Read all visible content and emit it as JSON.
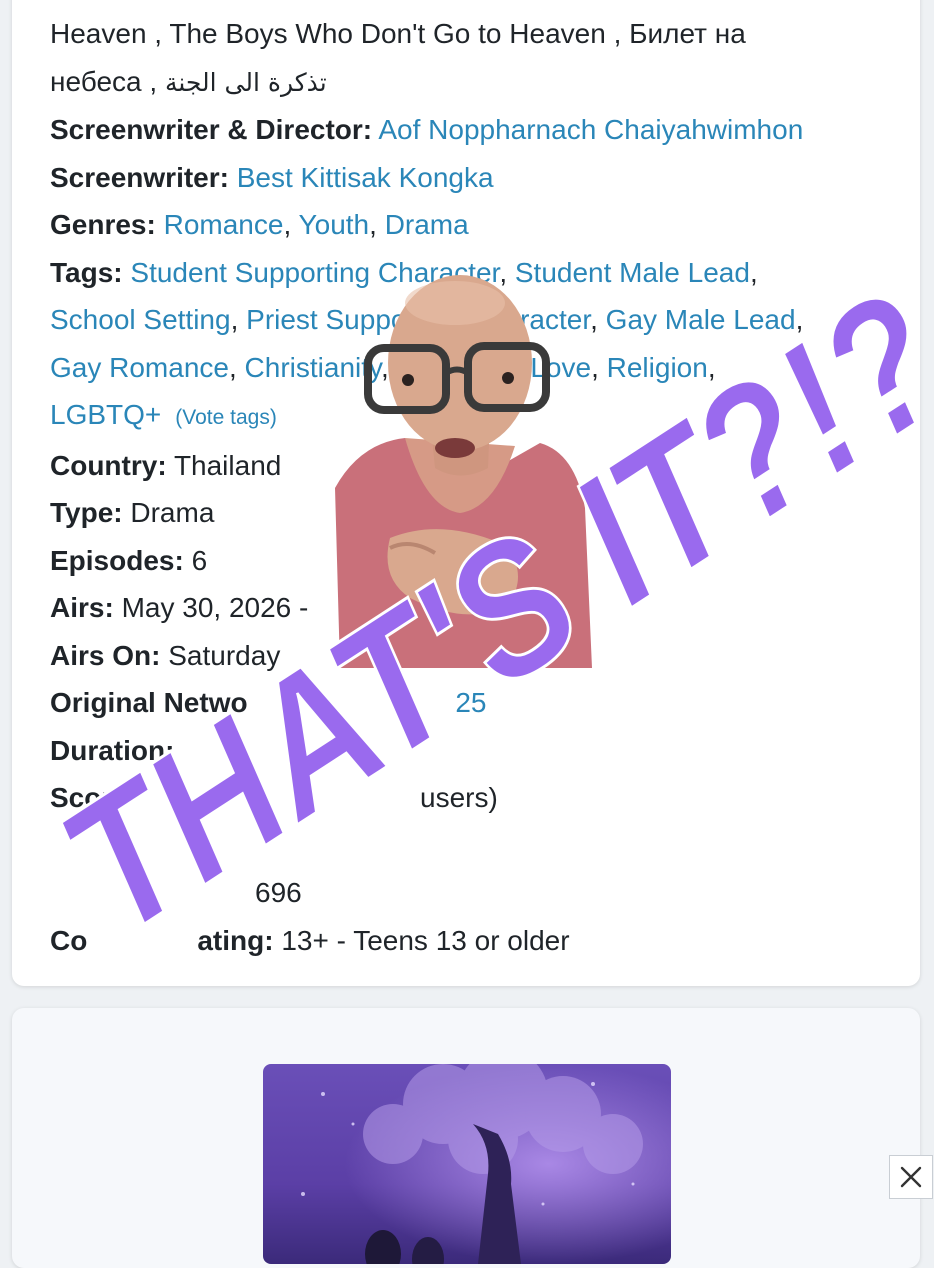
{
  "details": {
    "alt_titles_line1": "Heaven , The Boys Who Don't Go to Heaven , Билет на",
    "alt_titles_line2_ru": "небеса ,",
    "alt_titles_line2_ar": "تذكرة الى الجنة",
    "screenwriter_director": {
      "label": "Screenwriter & Director:",
      "value": "Aof Noppharnach Chaiyahwimhon"
    },
    "screenwriter": {
      "label": "Screenwriter:",
      "value": "Best Kittisak Kongka"
    },
    "genres": {
      "label": "Genres:",
      "items": [
        "Romance",
        "Youth",
        "Drama"
      ]
    },
    "tags": {
      "label": "Tags:",
      "line1": [
        "Student Supporting Character",
        "Student Male Lead"
      ],
      "line2": [
        "School Setting",
        "Priest Supporting Character",
        "Gay Male Lead"
      ],
      "line3": [
        "Gay Romance",
        "Christianity",
        "Forbidden Love",
        "Religion"
      ],
      "line4": "LGBTQ+",
      "vote": "(Vote tags)"
    },
    "country": {
      "label": "Country:",
      "value": "Thailand"
    },
    "type": {
      "label": "Type:",
      "value": "Drama"
    },
    "episodes": {
      "label": "Episodes:",
      "value": "6"
    },
    "airs": {
      "label": "Airs:",
      "value": "May 30, 2026 - "
    },
    "airs_on": {
      "label": "Airs On:",
      "value": "Saturday"
    },
    "original_network": {
      "label": "Original Netwo",
      "value": "25"
    },
    "duration": {
      "label": "Duration:",
      "value": ""
    },
    "score": {
      "label": "Scor",
      "value": "users)"
    },
    "partial_value": "696",
    "content_rating": {
      "label": "Co",
      "label_tail": "ating:",
      "value": "13+ - Teens 13 or older"
    }
  },
  "overlay_text": "THAT'S IT?!?",
  "close_icon": "close-icon",
  "colors": {
    "link": "#2a86b8",
    "overlay": "#9a6aee",
    "card": "#ffffff",
    "background": "#eef1f4"
  }
}
